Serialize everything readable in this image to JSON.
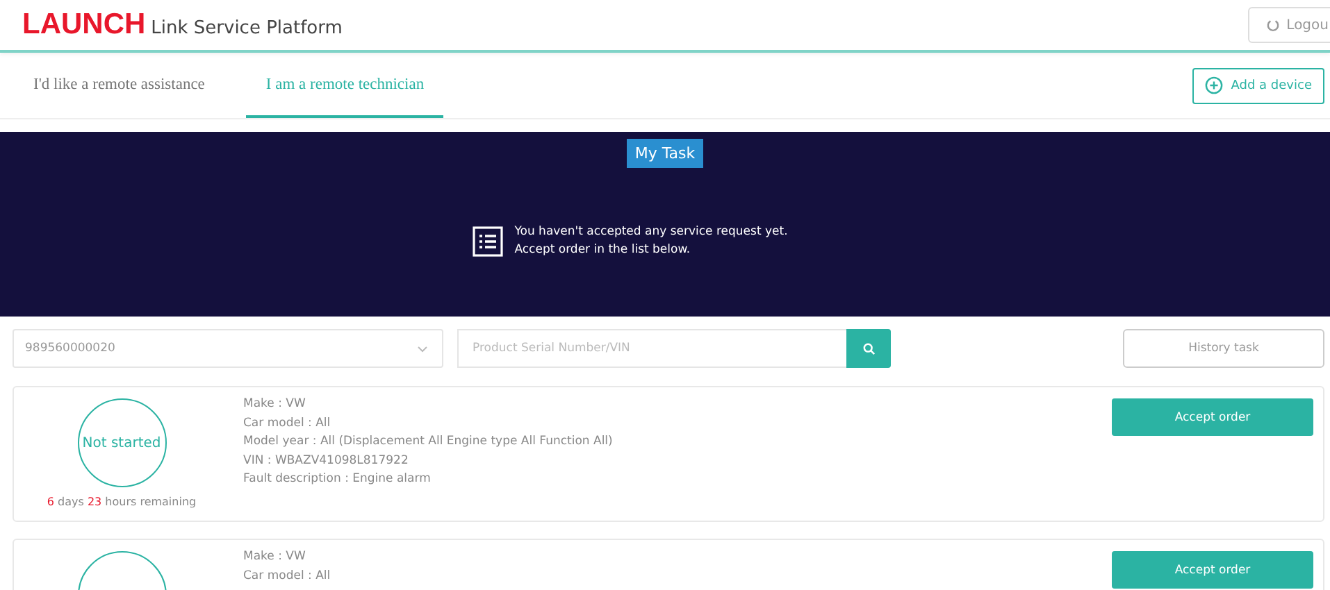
{
  "header": {
    "logo": "LAUNCH",
    "title": "Link Service Platform",
    "logout": "Logou"
  },
  "tabs": [
    {
      "label": "I'd like a remote assistance",
      "selected": false
    },
    {
      "label": "I am a remote technician",
      "selected": true
    }
  ],
  "add_device": "Add a device",
  "banner": {
    "badge": "My Task",
    "lines": [
      "You haven't accepted any service request yet.",
      "Accept order in the list below."
    ]
  },
  "filters": {
    "device": "989560000020",
    "search": {
      "placeholder": "Product Serial Number/VIN"
    },
    "history": "History task"
  },
  "tasks": [
    {
      "status": "Not started",
      "remaining": [
        {
          "text": "6",
          "highlight": true
        },
        {
          "text": " days ",
          "highlight": false
        },
        {
          "text": "23",
          "highlight": true
        },
        {
          "text": " hours remaining",
          "highlight": false
        }
      ],
      "details": [
        "Make : VW",
        "Car model : All",
        "Model year : All (Displacement All Engine type All Function All)",
        "VIN : WBAZV41098L817922",
        "Fault description : Engine alarm"
      ],
      "action": "Accept order"
    },
    {
      "details": [
        "Make : VW",
        "Car model : All"
      ],
      "action": "Accept order"
    }
  ]
}
